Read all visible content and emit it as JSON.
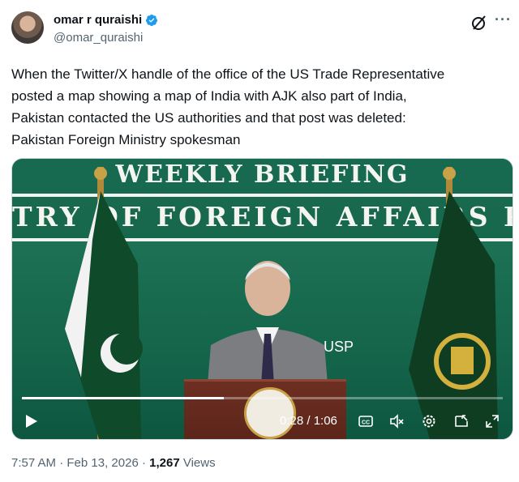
{
  "author": {
    "display_name": "omar r quraishi",
    "handle": "@omar_quraishi",
    "verified": true
  },
  "post": {
    "text": "When the Twitter/X handle of the office of the US Trade Representative\nposted a map showing a map of India with AJK also part of India,\nPakistan contacted the US authorities and that post was deleted:\nPakistan Foreign Ministry spokesman"
  },
  "video": {
    "banner_line1": "WEEKLY BRIEFING",
    "banner_line2": "TRY OF FOREIGN AFFAIRS PA",
    "overlay_text": "USP",
    "current_time": "0:28",
    "duration": "1:06",
    "time_display": "0:28 / 1:06",
    "progress": 0.42
  },
  "meta": {
    "time": "7:57 AM",
    "separator": "·",
    "date": "Feb 13, 2026",
    "views_count": "1,267",
    "views_label": "Views"
  },
  "icons": {
    "verified": "verified-badge-icon",
    "grok": "grok-icon",
    "more": "more-icon",
    "play": "play-icon",
    "captions": "captions-icon",
    "mute": "mute-icon",
    "settings": "settings-icon",
    "pip": "pip-icon",
    "fullscreen": "fullscreen-icon"
  },
  "colors": {
    "verified_blue": "#1d9bf0",
    "secondary_text": "#536471",
    "banner_green": "#17694f"
  }
}
